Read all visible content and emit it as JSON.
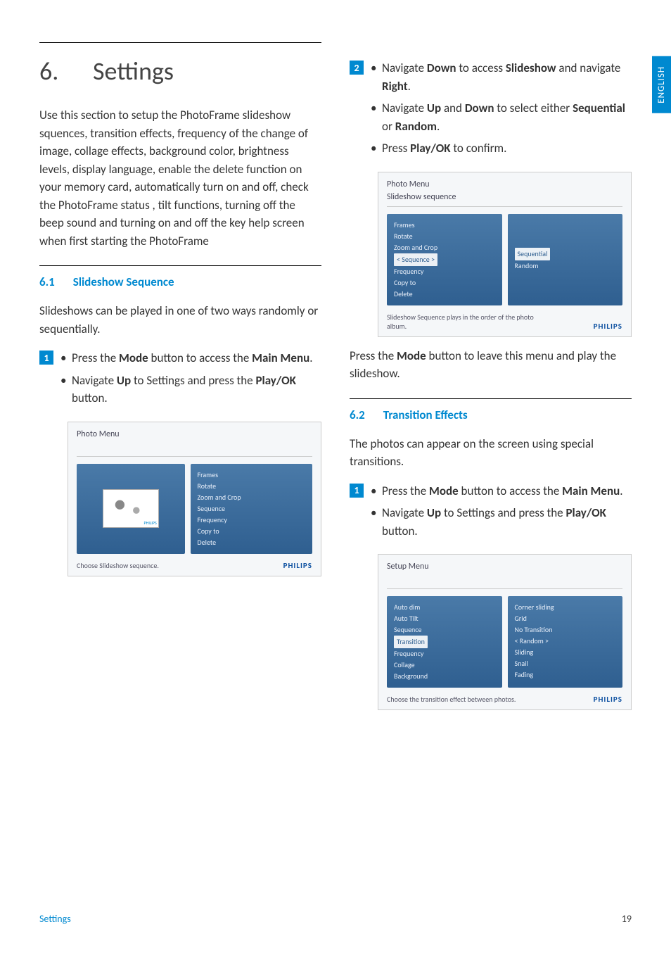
{
  "lang_tab": "ENGLISH",
  "chapter": {
    "number": "6.",
    "title": "Settings"
  },
  "intro_text": "Use this section to setup the PhotoFrame slideshow squences, transition effects, frequency of the change of image, collage effects, background color, brightness levels, display language, enable the delete function on your memory card, automatically turn on and off, check the PhotoFrame status , tilt functions, turning off the beep sound and turning on and off the key help screen when first starting the PhotoFrame",
  "section61": {
    "num": "6.1",
    "title": "Slideshow Sequence"
  },
  "section61_intro": "Slideshows can be played in one of two ways randomly or sequentially.",
  "step1_badge": "1",
  "step1_a_pre": "Press the ",
  "step1_a_b1": "Mode",
  "step1_a_mid": " button to access the ",
  "step1_a_b2": "Main Menu",
  "step1_a_post": ".",
  "step1_b_pre": "Navigate ",
  "step1_b_b1": "Up",
  "step1_b_mid": " to Settings and press the ",
  "step1_b_b2": "Play/OK",
  "step1_b_post": " button.",
  "screen1": {
    "title": "Photo Menu",
    "menu": [
      "Frames",
      "Rotate",
      "Zoom and Crop",
      "Sequence",
      "Frequency",
      "Copy to",
      "Delete"
    ],
    "hint": "Choose Slideshow sequence.",
    "brand": "PHILIPS",
    "thumb_brand": "PHILIPS"
  },
  "step2_badge": "2",
  "step2_a_pre": "Navigate ",
  "step2_a_b1": "Down",
  "step2_a_mid": " to access ",
  "step2_a_b2": "Slideshow",
  "step2_a_mid2": " and navigate ",
  "step2_a_b3": "Right",
  "step2_a_post": ".",
  "step2_b_pre": "Navigate ",
  "step2_b_b1": "Up",
  "step2_b_mid": " and ",
  "step2_b_b2": "Down",
  "step2_b_mid2": " to select either ",
  "step2_b_b3": "Sequential",
  "step2_b_mid3": " or ",
  "step2_b_b4": "Random",
  "step2_b_post": ".",
  "step2_c_pre": "Press ",
  "step2_c_b1": "Play/OK",
  "step2_c_post": " to confirm.",
  "screen2": {
    "title": "Photo Menu",
    "sub": "Slideshow sequence",
    "left_menu": [
      "Frames",
      "Rotate",
      "Zoom and Crop",
      "< Sequence >",
      "Frequency",
      "Copy to",
      "Delete"
    ],
    "left_selected": "< Sequence >",
    "right_menu": [
      "Sequential",
      "Random"
    ],
    "right_selected": "Sequential",
    "hint": "Slideshow Sequence plays in the order of the photo album.",
    "brand": "PHILIPS"
  },
  "after_screen2_pre": "Press the ",
  "after_screen2_b": "Mode",
  "after_screen2_post": " button to leave this menu and play the slideshow.",
  "section62": {
    "num": "6.2",
    "title": "Transition Effects"
  },
  "section62_intro": "The photos can appear on the screen using special transitions.",
  "step62_1_badge": "1",
  "step62_1a_pre": "Press the ",
  "step62_1a_b1": "Mode",
  "step62_1a_mid": " button to access the ",
  "step62_1a_b2": "Main Menu",
  "step62_1a_post": ".",
  "step62_1b_pre": "Navigate ",
  "step62_1b_b1": "Up",
  "step62_1b_mid": " to Settings and press the ",
  "step62_1b_b2": "Play/OK",
  "step62_1b_post": " button.",
  "screen3": {
    "title": "Setup Menu",
    "left_menu": [
      "Auto dim",
      "Auto Tilt",
      "Sequence",
      "Transition",
      "Frequency",
      "Collage",
      "Background"
    ],
    "left_selected": "Transition",
    "right_menu": [
      "Corner sliding",
      "Grid",
      "No Transition",
      "< Random >",
      "Sliding",
      "Snail",
      "Fading"
    ],
    "hint": "Choose the transition effect between photos.",
    "brand": "PHILIPS"
  },
  "footer": {
    "label": "Settings",
    "page": "19"
  }
}
